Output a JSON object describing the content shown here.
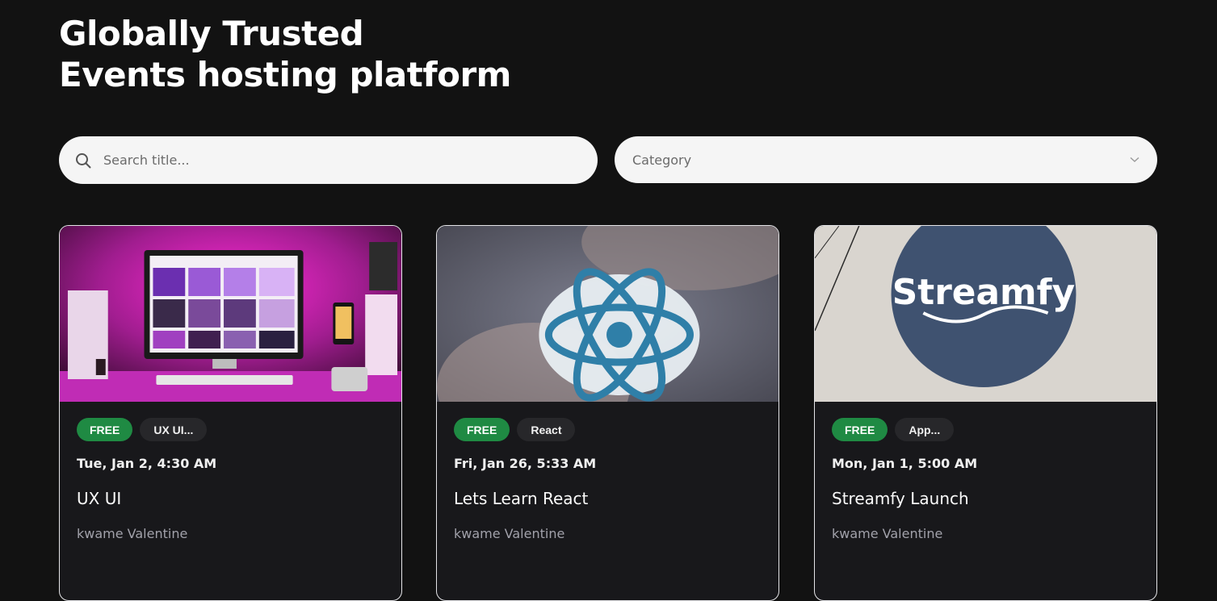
{
  "hero": {
    "title_line1": "Globally Trusted",
    "title_line2": "Events hosting platform"
  },
  "search": {
    "placeholder": "Search title...",
    "value": ""
  },
  "filter": {
    "category_label": "Category"
  },
  "events": [
    {
      "price_badge": "FREE",
      "category": "UX UI...",
      "date": "Tue, Jan 2, 4:30 AM",
      "title": "UX UI",
      "organizer": "kwame Valentine"
    },
    {
      "price_badge": "FREE",
      "category": "React",
      "date": "Fri, Jan 26, 5:33 AM",
      "title": "Lets Learn React",
      "organizer": "kwame Valentine"
    },
    {
      "price_badge": "FREE",
      "category": "App...",
      "date": "Mon, Jan 1, 5:00 AM",
      "title": "Streamfy Launch",
      "organizer": "kwame Valentine",
      "logo_text": "Streamfy"
    }
  ],
  "colors": {
    "background": "#121212",
    "card": "#18181b",
    "free_badge": "#1f8a43",
    "category_badge": "#27272a",
    "organizer_text": "#a1a1aa"
  }
}
